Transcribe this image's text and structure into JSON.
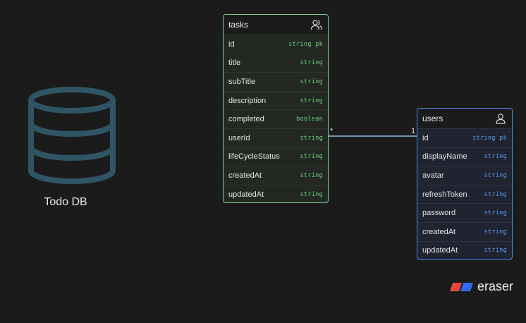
{
  "database": {
    "label": "Todo DB",
    "icon": "database-icon"
  },
  "tasks": {
    "title": "tasks",
    "icon": "users-icon",
    "fields": [
      {
        "name": "id",
        "type": "string pk"
      },
      {
        "name": "title",
        "type": "string"
      },
      {
        "name": "subTitle",
        "type": "string"
      },
      {
        "name": "description",
        "type": "string"
      },
      {
        "name": "completed",
        "type": "boolean"
      },
      {
        "name": "userId",
        "type": "string"
      },
      {
        "name": "lifeCycleStatus",
        "type": "string"
      },
      {
        "name": "createdAt",
        "type": "string"
      },
      {
        "name": "updatedAt",
        "type": "string"
      }
    ]
  },
  "users": {
    "title": "users",
    "icon": "user-icon",
    "fields": [
      {
        "name": "id",
        "type": "string pk"
      },
      {
        "name": "displayName",
        "type": "string"
      },
      {
        "name": "avatar",
        "type": "string"
      },
      {
        "name": "refreshToken",
        "type": "string"
      },
      {
        "name": "password",
        "type": "string"
      },
      {
        "name": "createdAt",
        "type": "string"
      },
      {
        "name": "updatedAt",
        "type": "string"
      }
    ]
  },
  "relationship": {
    "from_cardinality": "*",
    "to_cardinality": "1"
  },
  "brand": {
    "name": "eraser"
  },
  "colors": {
    "tasks_accent": "#7fcf8e",
    "users_accent": "#4f8fe6",
    "db_icon": "#2f5564"
  }
}
